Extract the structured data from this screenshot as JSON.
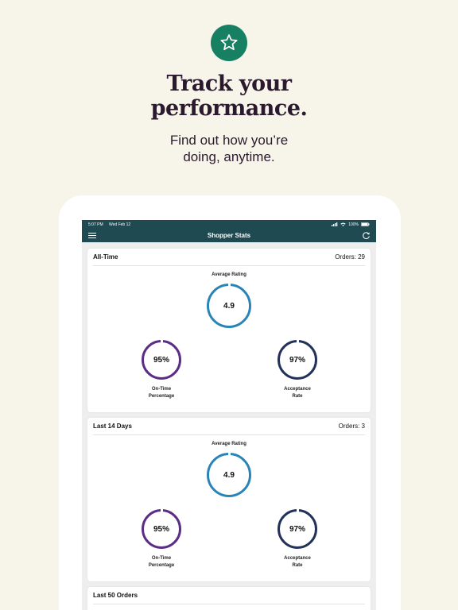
{
  "hero": {
    "headline_line1": "Track your",
    "headline_line2": "performance.",
    "subline_line1": "Find out how you’re",
    "subline_line2": "doing, anytime."
  },
  "status_bar": {
    "time": "5:07 PM",
    "date": "Wed Feb 12",
    "battery": "100%"
  },
  "nav": {
    "title": "Shopper Stats"
  },
  "cards": [
    {
      "title": "All-Time",
      "orders": "Orders: 29",
      "avg_label": "Average Rating",
      "rating": "4.9",
      "on_time": "95%",
      "on_time_label_1": "On-Time",
      "on_time_label_2": "Percentage",
      "acceptance": "97%",
      "acceptance_label_1": "Acceptance",
      "acceptance_label_2": "Rate"
    },
    {
      "title": "Last 14 Days",
      "orders": "Orders: 3",
      "avg_label": "Average Rating",
      "rating": "4.9",
      "on_time": "95%",
      "on_time_label_1": "On-Time",
      "on_time_label_2": "Percentage",
      "acceptance": "97%",
      "acceptance_label_1": "Acceptance",
      "acceptance_label_2": "Rate"
    },
    {
      "title": "Last 50 Orders"
    }
  ],
  "colors": {
    "brand_green": "#178063",
    "nav_teal": "#1f4a52",
    "rating_blue": "#2a84b8",
    "ontime_purple": "#5b2d87",
    "acceptance_navy": "#23325a"
  },
  "icons": {
    "badge": "star-icon",
    "menu": "hamburger-menu-icon",
    "refresh": "refresh-icon"
  }
}
